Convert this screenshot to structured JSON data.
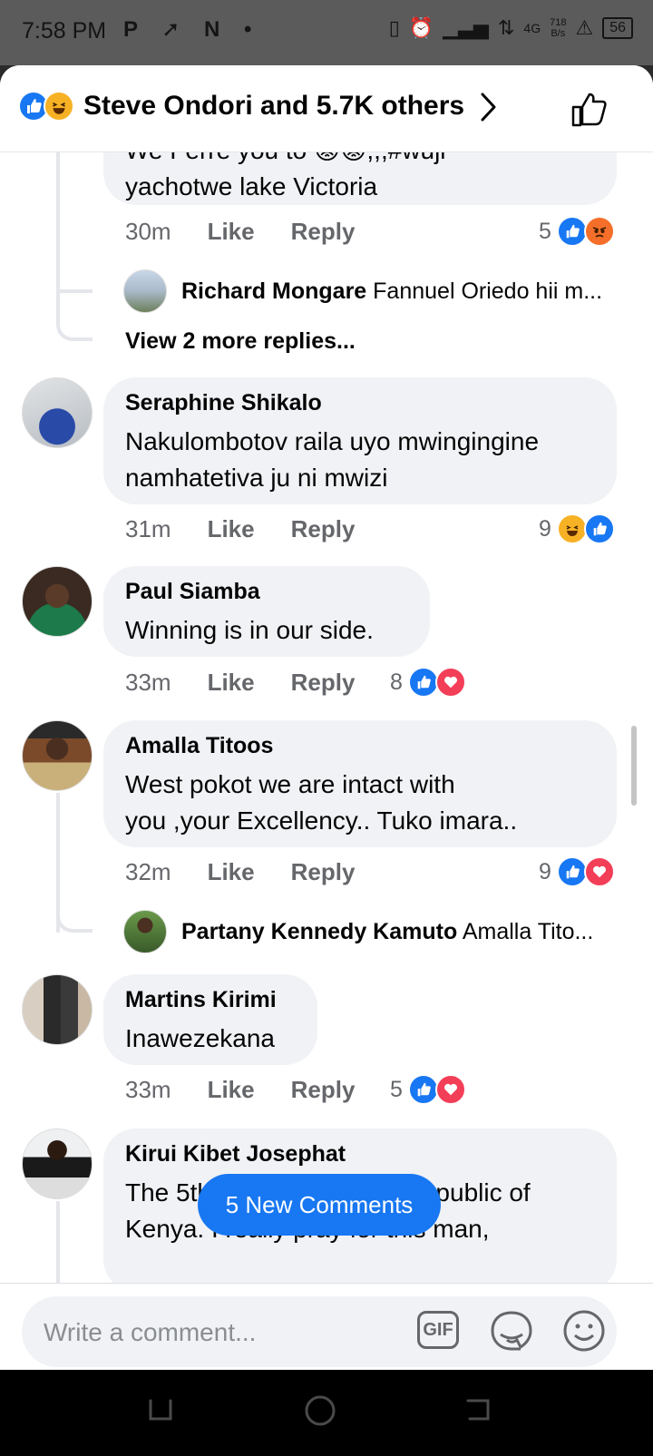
{
  "status_bar": {
    "time": "7:58 PM",
    "left_icons": "P ➚ N •",
    "net_label": "4G",
    "net_speed_value": "718",
    "net_speed_unit": "B/s",
    "battery": "56"
  },
  "header": {
    "title": "Steve Ondori and 5.7K others"
  },
  "top_partial": {
    "line1": "We Ferre you to 😡😡,,,#wuji",
    "line2": "yachotwe lake Victoria",
    "time": "30m",
    "like": "Like",
    "reply": "Reply",
    "reaction_count": "5"
  },
  "reply1": {
    "name": "Richard Mongare",
    "text": "Fannuel Oriedo hii m..."
  },
  "view_more": "View 2 more replies...",
  "comments": [
    {
      "author": "Seraphine Shikalo",
      "text1": "Nakulombotov raila uyo mwingingine",
      "text2": "namhatetiva ju ni mwizi",
      "time": "31m",
      "like": "Like",
      "reply": "Reply",
      "reaction_count": "9"
    },
    {
      "author": "Paul Siamba",
      "text1": "Winning is in our side.",
      "time": "33m",
      "like": "Like",
      "reply": "Reply",
      "reaction_count": "8"
    },
    {
      "author": "Amalla Titoos",
      "text1": "West pokot we are intact with",
      "text2": "you ,your Excellency.. Tuko imara..",
      "time": "32m",
      "like": "Like",
      "reply": "Reply",
      "reaction_count": "9"
    },
    {
      "author": "Martins Kirimi",
      "text1": "Inawezekana",
      "time": "33m",
      "like": "Like",
      "reply": "Reply",
      "reaction_count": "5"
    },
    {
      "author": "Kirui Kibet Josephat",
      "text1": "The 5th President of the Republic of",
      "text2": "Kenya. I really pray for this man,"
    }
  ],
  "reply2": {
    "name": "Partany Kennedy Kamuto",
    "text": "Amalla Tito..."
  },
  "new_comments": "5 New Comments",
  "composer": {
    "placeholder": "Write a comment...",
    "gif": "GIF"
  },
  "colors": {
    "accent": "#1877f2",
    "bubble": "#f0f2f5",
    "meta": "#65676b"
  }
}
